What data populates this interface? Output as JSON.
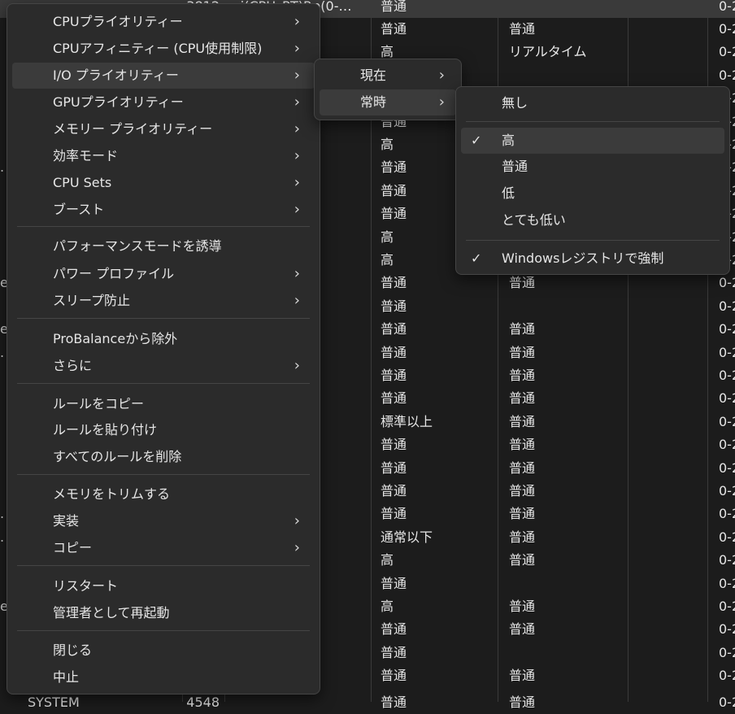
{
  "table": {
    "top_row": {
      "name": "",
      "pid": "3812",
      "affinity": "ai(CPU_RT)Rp(0-…",
      "priority": "普通",
      "cpu": "0-2"
    },
    "rows": [
      {
        "edge": "",
        "priority": "普通",
        "io": "普通",
        "cpu": "0-2"
      },
      {
        "edge": "",
        "priority": "高",
        "io": "リアルタイム",
        "cpu": "0-2"
      },
      {
        "edge": "",
        "priority": "",
        "io": "",
        "cpu": "0-2"
      },
      {
        "edge": "",
        "priority": "",
        "io": "",
        "cpu": "0-2"
      },
      {
        "edge": "",
        "priority": "普通",
        "io": "",
        "cpu": "0-2"
      },
      {
        "edge": "",
        "priority": "高",
        "io": "",
        "cpu": "0-2"
      },
      {
        "edge": ".",
        "priority": "普通",
        "io": "",
        "cpu": "0-2"
      },
      {
        "edge": "",
        "priority": "普通",
        "io": "",
        "cpu": "0-2"
      },
      {
        "edge": "",
        "priority": "普通",
        "io": "",
        "cpu": "0-2"
      },
      {
        "edge": "",
        "priority": "高",
        "io": "",
        "cpu": "0-2"
      },
      {
        "edge": "",
        "priority": "高",
        "io": "",
        "cpu": "0-2"
      },
      {
        "edge": "e",
        "priority": "普通",
        "io": "普通",
        "cpu": "0-2"
      },
      {
        "edge": "",
        "priority": "普通",
        "io": "",
        "cpu": "0-2"
      },
      {
        "edge": "e",
        "priority": "普通",
        "io": "普通",
        "cpu": "0-2"
      },
      {
        "edge": ".",
        "priority": "普通",
        "io": "普通",
        "cpu": "0-2"
      },
      {
        "edge": "",
        "priority": "普通",
        "io": "普通",
        "cpu": "0-2"
      },
      {
        "edge": "",
        "priority": "普通",
        "io": "普通",
        "cpu": "0-2"
      },
      {
        "edge": "",
        "priority": "標準以上",
        "io": "普通",
        "cpu": "0-2"
      },
      {
        "edge": "",
        "priority": "普通",
        "io": "普通",
        "cpu": "0-2"
      },
      {
        "edge": "",
        "priority": "普通",
        "io": "普通",
        "cpu": "0-2"
      },
      {
        "edge": "",
        "priority": "普通",
        "io": "普通",
        "cpu": "0-2"
      },
      {
        "edge": ".",
        "priority": "普通",
        "io": "普通",
        "cpu": "0-2"
      },
      {
        "edge": ".",
        "priority": "通常以下",
        "io": "普通",
        "cpu": "0-2"
      },
      {
        "edge": "",
        "priority": "高",
        "io": "普通",
        "cpu": "0-2"
      },
      {
        "edge": "",
        "priority": "普通",
        "io": "",
        "cpu": "0-2"
      },
      {
        "edge": "e",
        "priority": "高",
        "io": "普通",
        "cpu": "0-2"
      },
      {
        "edge": "",
        "priority": "普通",
        "io": "普通",
        "cpu": "0-2"
      },
      {
        "edge": "",
        "priority": "普通",
        "io": "",
        "cpu": "0-2"
      },
      {
        "edge": "",
        "priority": "普通",
        "io": "普通",
        "cpu": "0-2"
      }
    ],
    "bottom_row": {
      "name": "SYSTEM",
      "pid": "4548",
      "priority": "普通",
      "io": "普通",
      "cpu": "0-2"
    }
  },
  "main_menu": {
    "items": [
      {
        "label": "CPUプライオリティー",
        "submenu": true
      },
      {
        "label": "CPUアフィニティー (CPU使用制限)",
        "submenu": true
      },
      {
        "label": "I/O プライオリティー",
        "submenu": true
      },
      {
        "label": "GPUプライオリティー",
        "submenu": true
      },
      {
        "label": "メモリー プライオリティー",
        "submenu": true
      },
      {
        "label": "効率モード",
        "submenu": true
      },
      {
        "label": "CPU Sets",
        "submenu": true
      },
      {
        "label": "ブースト",
        "submenu": true
      },
      {
        "label": "パフォーマンスモードを誘導",
        "submenu": false
      },
      {
        "label": "パワー プロファイル",
        "submenu": true
      },
      {
        "label": "スリープ防止",
        "submenu": true
      },
      {
        "label": "ProBalanceから除外",
        "submenu": false
      },
      {
        "label": "さらに",
        "submenu": true
      },
      {
        "label": "ルールをコピー",
        "submenu": false
      },
      {
        "label": "ルールを貼り付け",
        "submenu": false
      },
      {
        "label": "すべてのルールを削除",
        "submenu": false
      },
      {
        "label": "メモリをトリムする",
        "submenu": false
      },
      {
        "label": "実装",
        "submenu": true
      },
      {
        "label": "コピー",
        "submenu": true
      },
      {
        "label": "リスタート",
        "submenu": false
      },
      {
        "label": "管理者として再起動",
        "submenu": false
      },
      {
        "label": "閉じる",
        "submenu": false
      },
      {
        "label": "中止",
        "submenu": false
      }
    ],
    "arrow": "›"
  },
  "io_menu": {
    "items": [
      {
        "label": "現在"
      },
      {
        "label": "常時"
      }
    ]
  },
  "always_menu": {
    "items": [
      {
        "label": "無し",
        "checked": false
      },
      {
        "label": "高",
        "checked": true
      },
      {
        "label": "普通",
        "checked": false
      },
      {
        "label": "低",
        "checked": false
      },
      {
        "label": "とても低い",
        "checked": false
      },
      {
        "label": "Windowsレジストリで強制",
        "checked": true
      }
    ],
    "check_glyph": "✓"
  },
  "colors": {
    "background": "#1c1c1c",
    "menu": "#2b2b2b",
    "highlight": "#3b3b3b",
    "text": "#e6e6e6"
  }
}
